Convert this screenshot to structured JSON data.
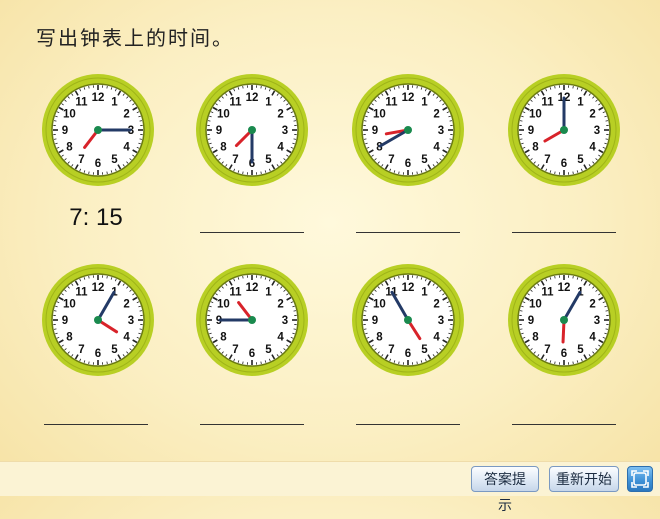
{
  "title": "写出钟表上的时间。",
  "clocks": [
    {
      "hour": 7,
      "minute": 15,
      "answer": "7: 15"
    },
    {
      "hour": 7,
      "minute": 30,
      "answer": ""
    },
    {
      "hour": 8,
      "minute": 40,
      "answer": ""
    },
    {
      "hour": 8,
      "minute": 0,
      "answer": ""
    },
    {
      "hour": 4,
      "minute": 5,
      "answer": ""
    },
    {
      "hour": 10,
      "minute": 45,
      "answer": ""
    },
    {
      "hour": 4,
      "minute": 55,
      "answer": ""
    },
    {
      "hour": 6,
      "minute": 5,
      "answer": ""
    }
  ],
  "buttons": {
    "hint": "答案提示",
    "restart": "重新开始"
  },
  "icons": {
    "fullscreen": "fullscreen-icon"
  },
  "colors": {
    "clock_rim": "#b8cf24",
    "minute_hand": "#233a66",
    "hour_hand": "#d8232a",
    "clock_center": "#1a8a4e"
  }
}
